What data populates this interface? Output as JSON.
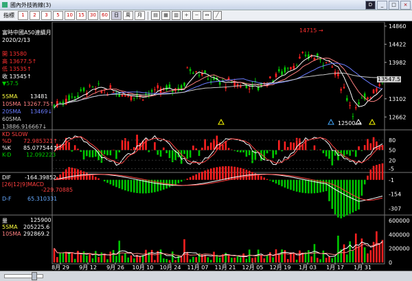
{
  "window": {
    "title": "國內外技術線(3)",
    "min": "_",
    "max": "□",
    "close": "×"
  },
  "toolbar": {
    "label": "指標",
    "periods": [
      "1",
      "2",
      "3",
      "5",
      "10",
      "15",
      "30",
      "60",
      "日",
      "周",
      "月"
    ]
  },
  "price_panel": {
    "name": "富時中國A50連續月",
    "date": "2020/2/13",
    "open_label": "開",
    "open": "13580",
    "high_label": "高",
    "high": "13677.5",
    "low_label": "低",
    "low": "13535",
    "close_label": "收",
    "close": "13545",
    "change": "57.5",
    "sma5_label": "5SMA",
    "sma5": "13481",
    "sma10_label": "10SMA",
    "sma10": "13267.75",
    "sma20_label": "20SMA",
    "sma20": "13469",
    "sma60_label": "60SMA",
    "sma60": "13886.916667",
    "annot_high": "14715",
    "annot_low": "12500",
    "last_price_tag": "13547.5",
    "y_ticks": [
      "14860",
      "14422",
      "13982",
      "13102",
      "12662"
    ]
  },
  "kd_panel": {
    "name": "KD SLOW",
    "d_label": "%D",
    "d": "72.985321",
    "k_label": "%K",
    "k": "85.077544",
    "kd_label": "K-D",
    "kd": "12.092223",
    "y_ticks": [
      "80",
      "50",
      "20",
      "-5"
    ]
  },
  "macd_panel": {
    "dif_label": "DIF",
    "dif": "-164.39852",
    "macd_label": "[26|12|9]MACD",
    "macd": "-229.70885",
    "df_label": "D-F",
    "df": "65.310331",
    "y_ticks": [
      "-1",
      "-154",
      "-307"
    ]
  },
  "vol_panel": {
    "name": "量",
    "vol": "125900",
    "sma5_label": "5SMA",
    "sma5": "205225.6",
    "sma10_label": "10SMA",
    "sma10": "292869.2",
    "y_ticks": [
      "600000",
      "400000",
      "200000",
      "0"
    ]
  },
  "x_axis": [
    "8月 29",
    "9月 12",
    "9月 26",
    "10月 10",
    "10月 24",
    "11月 07",
    "11月 21",
    "12月 05",
    "12月 19",
    "1月 03",
    "1月 17",
    "1月 31"
  ],
  "colors": {
    "up": "#ff2020",
    "down": "#00c800",
    "sma5": "#ffffff",
    "sma10": "#ff8080",
    "sma20": "#6a7cff",
    "sma60": "#c8c8c8",
    "text": "#ffffff"
  }
}
